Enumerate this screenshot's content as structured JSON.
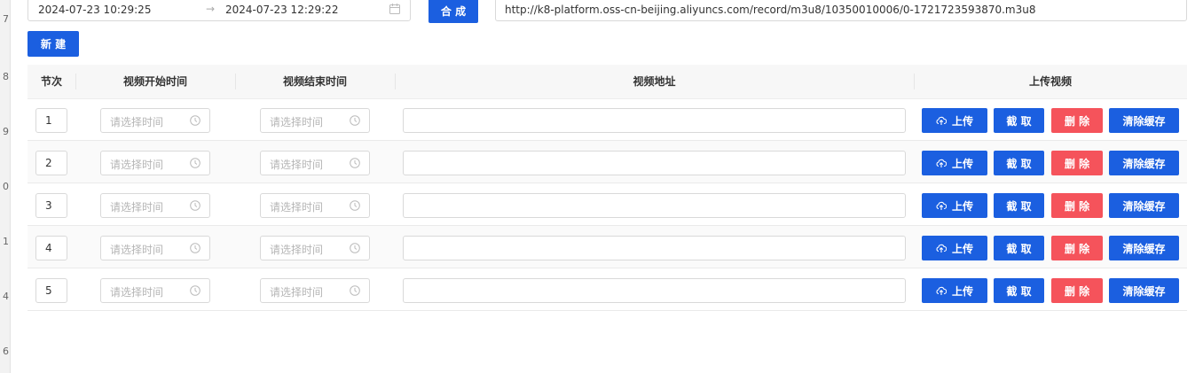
{
  "gutter": [
    "7",
    "8",
    "9",
    "0",
    "1",
    "4",
    "6"
  ],
  "range": {
    "start": "2024-07-23 10:29:25",
    "separator": "→",
    "end": "2024-07-23 12:29:22"
  },
  "compose_label": "合 成",
  "url_value": "http://k8-platform.oss-cn-beijing.aliyuncs.com/record/m3u8/10350010006/0-1721723593870.m3u8",
  "new_label": "新 建",
  "columns": {
    "index": "节次",
    "start": "视频开始时间",
    "end": "视频结束时间",
    "address": "视频地址",
    "upload": "上传视频"
  },
  "time_placeholder": "请选择时间",
  "actions": {
    "upload": "上传",
    "capture": "截 取",
    "delete": "删 除",
    "clear": "清除缓存"
  },
  "rows": [
    {
      "index": "1"
    },
    {
      "index": "2"
    },
    {
      "index": "3"
    },
    {
      "index": "4"
    },
    {
      "index": "5"
    }
  ],
  "icons": {
    "calendar": "calendar-icon",
    "clock": "clock-icon",
    "upload": "cloud-upload-icon"
  },
  "colors": {
    "primary": "#1b5fe0",
    "danger": "#f5535b",
    "header_bg": "#f7f7f7"
  }
}
